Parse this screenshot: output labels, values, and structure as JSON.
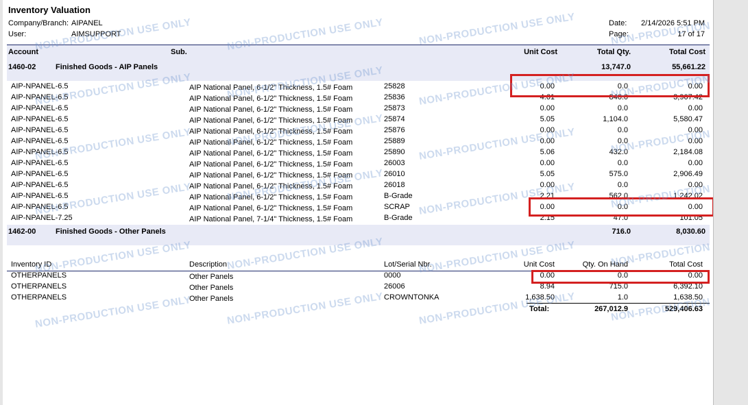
{
  "report": {
    "title": "Inventory Valuation",
    "company_label": "Company/Branch:",
    "company_value": "AIPANEL",
    "user_label": "User:",
    "user_value": "AIMSUPPORT",
    "date_label": "Date:",
    "date_value": "2/14/2026 5:51 PM",
    "page_label": "Page:",
    "page_value": "17 of 17"
  },
  "header1": {
    "account": "Account",
    "sub": "Sub.",
    "unit_cost": "Unit Cost",
    "total_qty": "Total Qty.",
    "total_cost": "Total Cost"
  },
  "group1": {
    "account": "1460-02",
    "name": "Finished Goods - AIP Panels",
    "qty": "13,747.0",
    "cost": "55,661.22"
  },
  "rows1": [
    {
      "id": "AIP-NPANEL-6.5",
      "desc": "AIP National Panel, 6-1/2\" Thickness, 1.5# Foam",
      "lot": "25828",
      "unit": "0.00",
      "qty": "0.0",
      "cost": "0.00"
    },
    {
      "id": "AIP-NPANEL-6.5",
      "desc": "AIP National Panel, 6-1/2\" Thickness, 1.5# Foam",
      "lot": "25836",
      "unit": "4.61",
      "qty": "846.0",
      "cost": "3,907.42"
    },
    {
      "id": "AIP-NPANEL-6.5",
      "desc": "AIP National Panel, 6-1/2\" Thickness, 1.5# Foam",
      "lot": "25873",
      "unit": "0.00",
      "qty": "0.0",
      "cost": "0.00"
    },
    {
      "id": "AIP-NPANEL-6.5",
      "desc": "AIP National Panel, 6-1/2\" Thickness, 1.5# Foam",
      "lot": "25874",
      "unit": "5.05",
      "qty": "1,104.0",
      "cost": "5,580.47"
    },
    {
      "id": "AIP-NPANEL-6.5",
      "desc": "AIP National Panel, 6-1/2\" Thickness, 1.5# Foam",
      "lot": "25876",
      "unit": "0.00",
      "qty": "0.0",
      "cost": "0.00"
    },
    {
      "id": "AIP-NPANEL-6.5",
      "desc": "AIP National Panel, 6-1/2\" Thickness, 1.5# Foam",
      "lot": "25889",
      "unit": "0.00",
      "qty": "0.0",
      "cost": "0.00"
    },
    {
      "id": "AIP-NPANEL-6.5",
      "desc": "AIP National Panel, 6-1/2\" Thickness, 1.5# Foam",
      "lot": "25890",
      "unit": "5.06",
      "qty": "432.0",
      "cost": "2,184.08"
    },
    {
      "id": "AIP-NPANEL-6.5",
      "desc": "AIP National Panel, 6-1/2\" Thickness, 1.5# Foam",
      "lot": "26003",
      "unit": "0.00",
      "qty": "0.0",
      "cost": "0.00"
    },
    {
      "id": "AIP-NPANEL-6.5",
      "desc": "AIP National Panel, 6-1/2\" Thickness, 1.5# Foam",
      "lot": "26010",
      "unit": "5.05",
      "qty": "575.0",
      "cost": "2,906.49"
    },
    {
      "id": "AIP-NPANEL-6.5",
      "desc": "AIP National Panel, 6-1/2\" Thickness, 1.5# Foam",
      "lot": "26018",
      "unit": "0.00",
      "qty": "0.0",
      "cost": "0.00"
    },
    {
      "id": "AIP-NPANEL-6.5",
      "desc": "AIP National Panel, 6-1/2\" Thickness, 1.5# Foam",
      "lot": "B-Grade",
      "unit": "2.21",
      "qty": "562.0",
      "cost": "1,242.02"
    },
    {
      "id": "AIP-NPANEL-6.5",
      "desc": "AIP National Panel, 6-1/2\" Thickness, 1.5# Foam",
      "lot": "SCRAP",
      "unit": "0.00",
      "qty": "0.0",
      "cost": "0.00"
    },
    {
      "id": "AIP-NPANEL-7.25",
      "desc": "AIP National Panel, 7-1/4\" Thickness, 1.5# Foam",
      "lot": "B-Grade",
      "unit": "2.15",
      "qty": "47.0",
      "cost": "101.05"
    }
  ],
  "group2": {
    "account": "1462-00",
    "name": "Finished Goods - Other Panels",
    "qty": "716.0",
    "cost": "8,030.60"
  },
  "header2": {
    "inventory_id": "Inventory ID",
    "description": "Description",
    "lot": "Lot/Serial Nbr.",
    "unit_cost": "Unit Cost",
    "qty": "Qty. On Hand",
    "total_cost": "Total Cost"
  },
  "rows2": [
    {
      "id": "OTHERPANELS",
      "desc": "Other Panels",
      "lot": "0000",
      "unit": "0.00",
      "qty": "0.0",
      "cost": "0.00"
    },
    {
      "id": "OTHERPANELS",
      "desc": "Other Panels",
      "lot": "26006",
      "unit": "8.94",
      "qty": "715.0",
      "cost": "6,392.10"
    },
    {
      "id": "OTHERPANELS",
      "desc": "Other Panels",
      "lot": "CROWNTONKA",
      "unit": "1,638.50",
      "qty": "1.0",
      "cost": "1,638.50"
    }
  ],
  "totals": {
    "label": "Total:",
    "qty": "267,012.9",
    "cost": "529,406.63"
  },
  "watermark": "NON-PRODUCTION USE ONLY",
  "colors": {
    "highlight": "#d42020",
    "header_band": "#e8eaf6",
    "rule": "#1e2a6b"
  }
}
